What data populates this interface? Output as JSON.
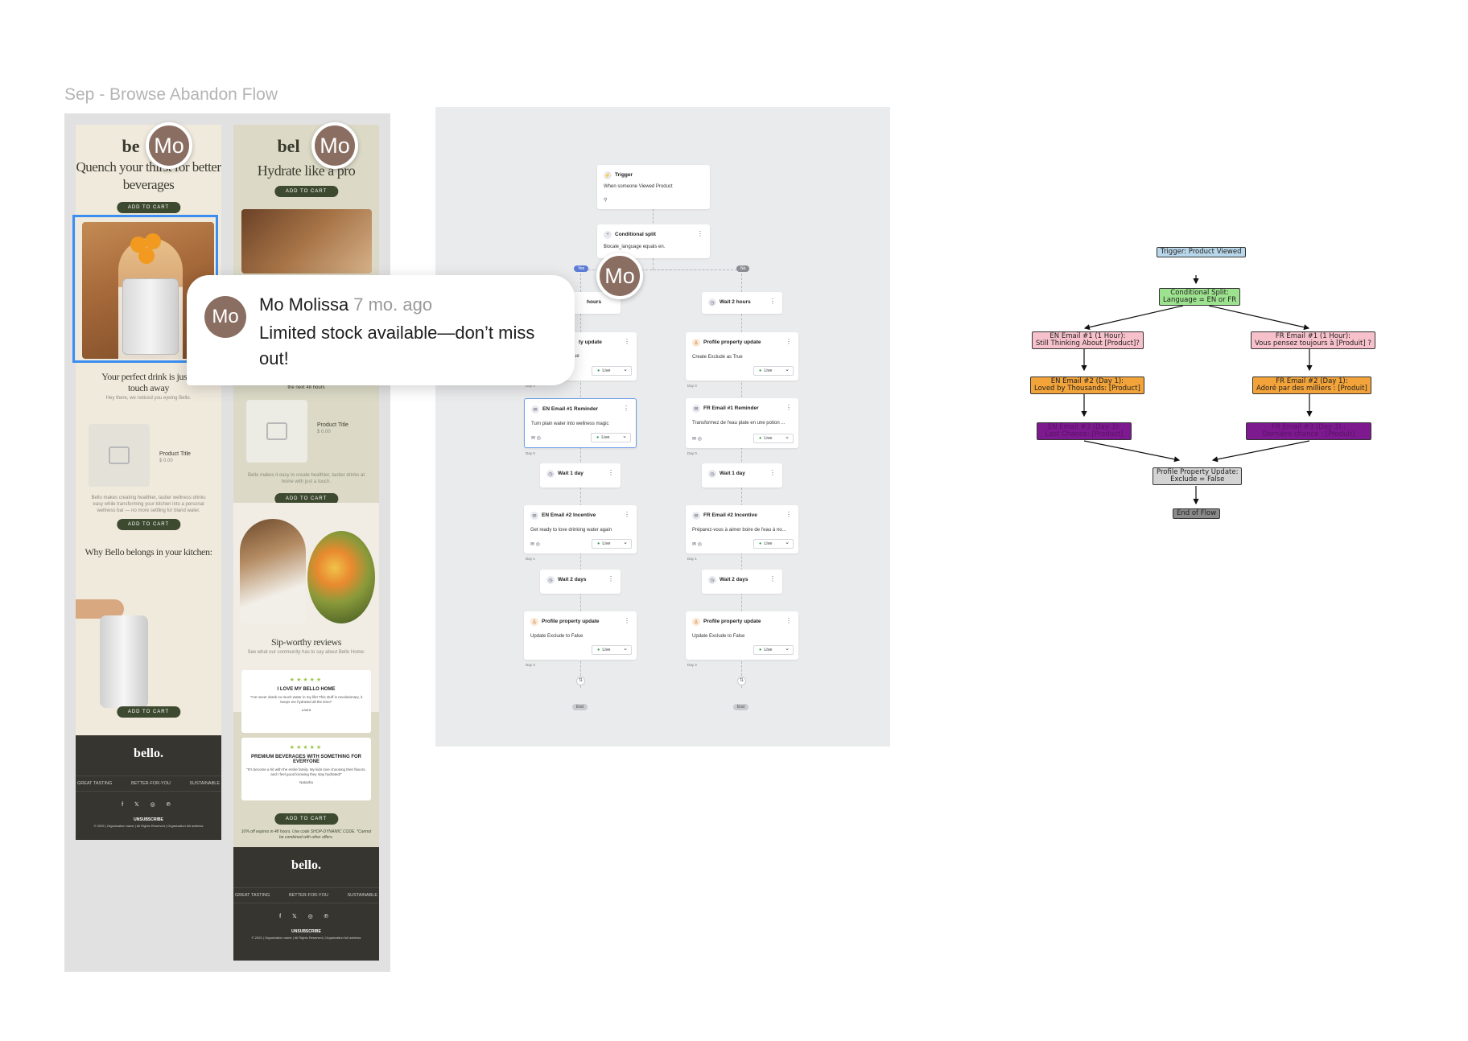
{
  "frame": {
    "title": "Sep - Browse Abandon Flow"
  },
  "email1": {
    "logo": "be",
    "headline": "Quench your thirst for better beverages",
    "cta": "ADD TO CART",
    "body_heading": "Your perfect drink is just a touch away",
    "body_sub": "Hey there, we noticed you eyeing Bello.",
    "product_title": "Product Title",
    "product_price": "$ 0.00",
    "copy": "Bello makes creating healthier, tastier wellness drinks easy while transforming your kitchen into a personal wellness bar — no more settling for bland water.",
    "cta2": "ADD TO CART",
    "section_heading": "Why Bello belongs in your kitchen:",
    "cta3": "ADD TO CART",
    "footer_logo": "bello.",
    "footer_nav": [
      "GREAT TASTING",
      "BETTER-FOR-YOU",
      "SUSTAINABLE"
    ],
    "footer_social": "f 𝕏 ◎ ℗",
    "footer_unsub": "UNSUBSCRIBE",
    "footer_copy": "© 2025 | Organization name | All Rights Reserved | Organization full address"
  },
  "email2": {
    "logo": "bel",
    "headline": "Hydrate like a pro",
    "cta": "ADD TO CART",
    "hours_text": "the next 48 hours",
    "product_title": "Product Title",
    "product_price": "$ 0.00",
    "copy": "Bello makes it easy to create healthier, tastier drinks at home with just a touch.",
    "cta2": "ADD TO CART",
    "reviews_heading": "Sip-worthy reviews",
    "reviews_sub": "See what our community has to say about Bello Home:",
    "review1": {
      "stars": "★★★★★",
      "title": "I LOVE MY BELLO HOME",
      "body": "\"I've never drank so much water in my life! This stuff is revolutionary, it keeps me hydrated all the time!\"",
      "name": "Laura"
    },
    "review2": {
      "stars": "★★★★★",
      "title": "PREMIUM BEVERAGES WITH SOMETHING FOR EVERYONE",
      "body": "\"It's become a hit with the entire family. My kids love choosing their flavors, and I feel good knowing they stay hydrated!\"",
      "name": "Natasha"
    },
    "cta3": "ADD TO CART",
    "promo": "10% off expires in 48 hours. Use code SHOP-DYNAMIC CODE. *Cannot be combined with other offers.",
    "footer_logo": "bello.",
    "footer_nav": [
      "GREAT TASTING",
      "BETTER-FOR-YOU",
      "SUSTAINABLE"
    ],
    "footer_social": "f 𝕏 ◎ ℗",
    "footer_unsub": "UNSUBSCRIBE",
    "footer_copy": "© 2025 | Organization name | All Rights Reserved | Organization full address"
  },
  "avatar_initials": "Mo",
  "comment": {
    "initials": "Mo",
    "author": "Mo Molissa",
    "time": "7 mo. ago",
    "message": "Limited stock available—don’t miss out!"
  },
  "flow": {
    "trigger": {
      "title": "Trigger",
      "desc": "When someone Viewed Product"
    },
    "split": {
      "title": "Conditional split",
      "desc": "$locale_language equals en."
    },
    "yes_label": "Yes",
    "no_label": "No",
    "live_label": "Live",
    "end_label": "End",
    "left": {
      "wait0": "hours",
      "profile1_title": "ty update",
      "profile1_desc": "ue",
      "email1_title": "EN Email #1 Reminder",
      "email1_desc": "Turn plain water into wellness magic",
      "wait1": "Wait 1 day",
      "email2_title": "EN Email #2 Incentive",
      "email2_desc": "Get ready to love drinking water again",
      "wait2": "Wait 2 days",
      "profile2_title": "Profile property update",
      "profile2_desc": "Update Exclude to False",
      "day0": "Day 0",
      "day1": "Day 1",
      "day3": "Day 3"
    },
    "right": {
      "wait0": "Wait 2 hours",
      "profile1_title": "Profile property update",
      "profile1_desc": "Create Exclude as True",
      "email1_title": "FR Email #1 Reminder",
      "email1_desc": "Transformez de l'eau plate en une potion ...",
      "wait1": "Wait 1 day",
      "email2_title": "FR Email #2 Incentive",
      "email2_desc": "Préparez-vous à aimer boire de l'eau à no...",
      "wait2": "Wait 2 days",
      "profile2_title": "Profile property update",
      "profile2_desc": "Update Exclude to False",
      "day0": "Day 0",
      "day1": "Day 1",
      "day3": "Day 3"
    }
  },
  "diagram": {
    "trigger": "Trigger: Product Viewed",
    "split_l1": "Conditional Split:",
    "split_l2": "Language = EN or FR",
    "en1_l1": "EN Email #1 (1 Hour):",
    "en1_l2": "Still Thinking About [Product]?",
    "fr1_l1": "FR Email #1 (1 Hour):",
    "fr1_l2": "Vous pensez toujours à [Produit] ?",
    "en2_l1": "EN Email #2 (Day 1):",
    "en2_l2": "Loved by Thousands: [Product]",
    "fr2_l1": "FR Email #2 (Day 1):",
    "fr2_l2": "Adoré par des milliers : [Produit]",
    "en3_l1": "EN Email #3 (Day 3):",
    "en3_l2": "Last Chance: [Product]",
    "fr3_l1": "FR Email #3 (Day 3) :",
    "fr3_l2": "Dernière chance : [Produit]",
    "profile_l1": "Profile Property Update:",
    "profile_l2": "Exclude = False",
    "end": "End of Flow",
    "colors": {
      "trigger": "#b9d7ea",
      "split": "#9de28e",
      "email1": "#f7c1cb",
      "email2": "#f2a33a",
      "email3": "#7d1a8f",
      "profile": "#d3d3d3",
      "end": "#8a8a8a"
    }
  }
}
